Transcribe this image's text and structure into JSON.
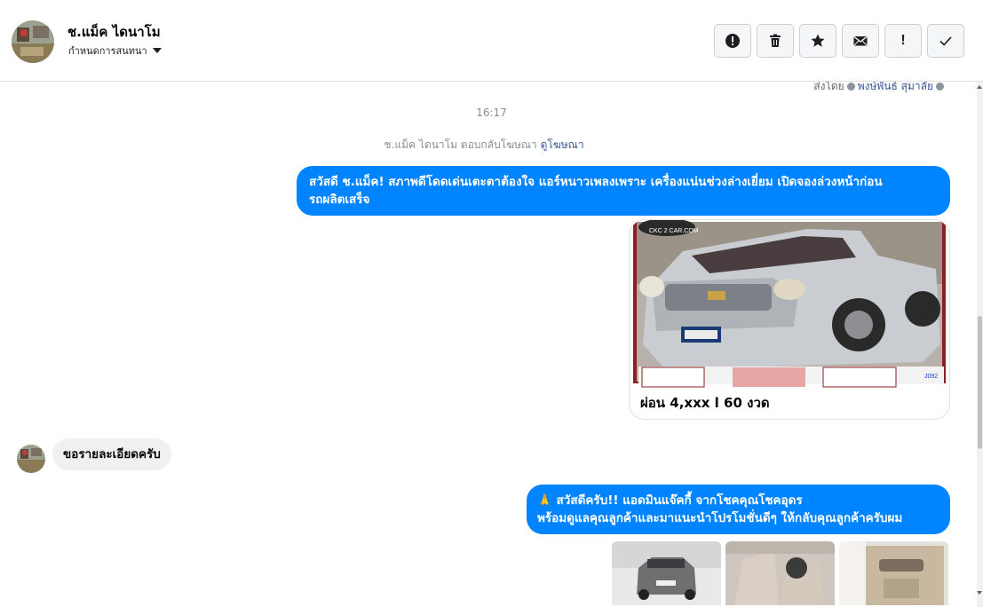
{
  "header": {
    "name": "ช.แม็ค ไดนาโม",
    "subtitle": "กำหนดการสนทนา",
    "actions": [
      {
        "name": "report-button",
        "icon": "alert-circle-icon"
      },
      {
        "name": "delete-button",
        "icon": "trash-icon"
      },
      {
        "name": "star-button",
        "icon": "star-icon"
      },
      {
        "name": "mark-unread-button",
        "icon": "envelope-icon"
      },
      {
        "name": "important-button",
        "icon": "exclamation-icon",
        "label": "!"
      },
      {
        "name": "done-button",
        "icon": "check-icon"
      }
    ]
  },
  "conversation": {
    "sent_by_prefix": "ส่งโดย",
    "sent_by_name": "พงษ์พันธ์ สุมาลัย",
    "timestamp": "16:17",
    "ad_reply_text": "ช.แม็ค ไดนาโม ตอบกลับโฆษณา",
    "ad_reply_link": "ดูโฆษณา",
    "messages": [
      {
        "direction": "out",
        "text_line1": "สวัสดี ช.แม็ค! สภาพดีโดดเด่นเตะตาต้องใจ แอร์หนาวเพลงเพราะ เครื่องแน่นช่วงล่างเยี่ยม เปิดจองล่วงหน้าก่อน",
        "text_line2": "รถผลิตเสร็จ"
      },
      {
        "direction": "out",
        "card_caption": "ผ่อน 4,xxx l 60 งวด",
        "card_logo": "CKC 2 CAR.COM",
        "card_code": "J092"
      },
      {
        "direction": "in",
        "text": "ขอรายละเอียดครับ"
      },
      {
        "direction": "out",
        "emoji": "🙏",
        "text_line1": "สวัสดีครับ!! แอดมินแจ๊คกี้ จากโชคคุณโชคอุดร",
        "text_line2": "พร้อมดูแลคุณลูกค้าและมาแนะนำโปรโมชั่นดีๆ ให้กลับคุณลูกค้าครับผม"
      }
    ]
  },
  "colors": {
    "outgoing_bubble": "#0084ff",
    "incoming_bubble": "#f0f0f0",
    "link": "#385898"
  }
}
